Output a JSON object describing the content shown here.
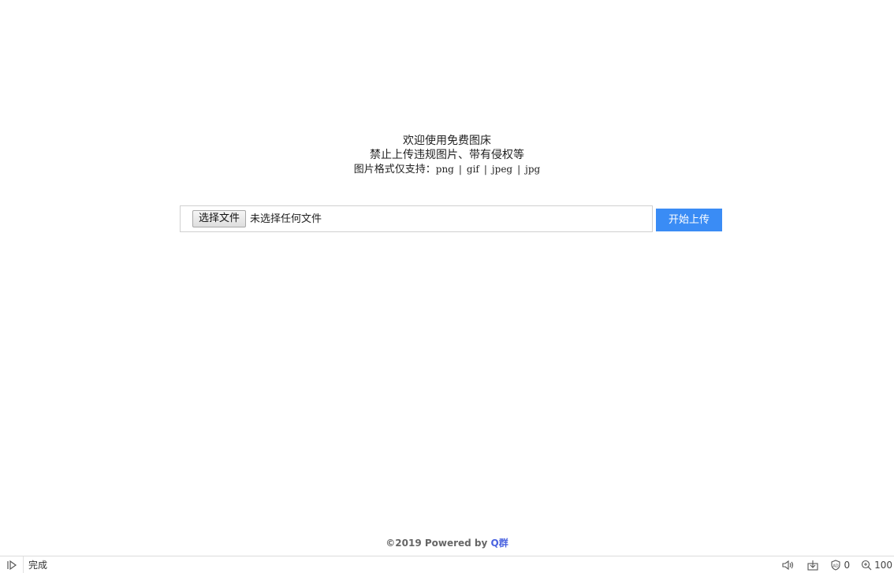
{
  "intro": {
    "line1": "欢迎使用免费图床",
    "line2": "禁止上传违规图片、带有侵权等",
    "formats_label": "图片格式仅支持：",
    "formats": [
      "png",
      "gif",
      "jpeg",
      "jpg"
    ],
    "separator": "|"
  },
  "upload": {
    "choose_label": "选择文件",
    "file_status": "未选择任何文件",
    "submit_label": "开始上传"
  },
  "footer": {
    "prefix": "©2019 Powered by ",
    "brand": "Q群"
  },
  "statusbar": {
    "status_text": "完成",
    "shield_count": "0",
    "zoom": "100"
  },
  "colors": {
    "upload_button": "#3a8cf5",
    "brand": "#4a63e0"
  }
}
